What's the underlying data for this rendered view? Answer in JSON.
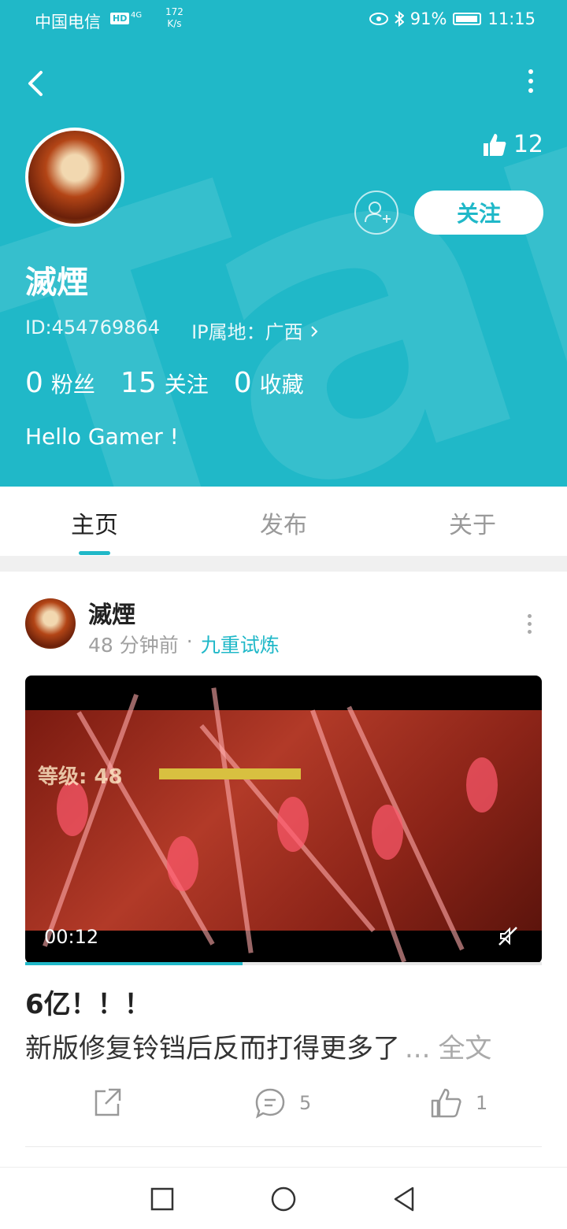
{
  "status_bar": {
    "carrier": "中国电信",
    "hd_badge": "HD",
    "signal": "4G",
    "speed": "172",
    "speed_unit": "K/s",
    "battery": "91%",
    "time": "11:15"
  },
  "profile": {
    "likes": "12",
    "follow_label": "关注",
    "username": "滅煙",
    "id_text": "ID:454769864",
    "ip_text": "IP属地：广西",
    "stats": [
      {
        "num": "0",
        "label": "粉丝"
      },
      {
        "num": "15",
        "label": "关注"
      },
      {
        "num": "0",
        "label": "收藏"
      }
    ],
    "bio": "Hello Gamer !"
  },
  "tabs": [
    {
      "label": "主页",
      "active": true
    },
    {
      "label": "发布",
      "active": false
    },
    {
      "label": "关于",
      "active": false
    }
  ],
  "post": {
    "author": "滅煙",
    "time_ago": "48 分钟前",
    "separator": "·",
    "topic": "九重试炼",
    "video": {
      "duration": "00:12",
      "progress": 0.42,
      "overlay_text": "等级: 48"
    },
    "title": "6亿！！！",
    "body": "新版修复铃铛后反而打得更多了",
    "ellipsis": "...",
    "read_more": "全文",
    "share_icon": "share-icon",
    "comments": "5",
    "likes": "1"
  },
  "colors": {
    "accent": "#20b8c8",
    "text_primary": "#222222",
    "text_secondary": "#a0a0a0"
  }
}
